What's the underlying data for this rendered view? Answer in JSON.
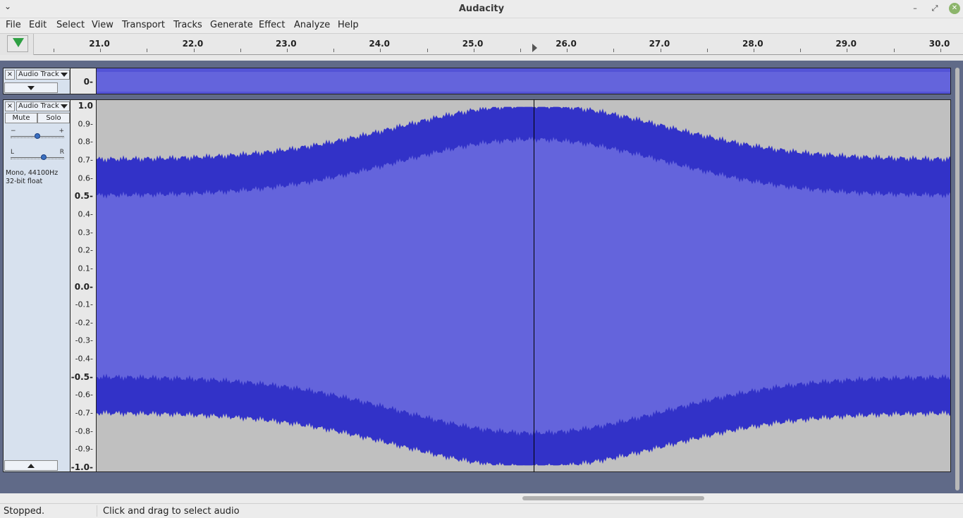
{
  "window": {
    "title": "Audacity",
    "menu_glyph": "⌄",
    "min": "–",
    "max": "⤢",
    "close": "✕"
  },
  "menu": [
    "File",
    "Edit",
    "Select",
    "View",
    "Transport",
    "Tracks",
    "Generate",
    "Effect",
    "Analyze",
    "Help"
  ],
  "ruler": {
    "labels": [
      "21.0",
      "22.0",
      "23.0",
      "24.0",
      "25.0",
      "26.0",
      "27.0",
      "28.0",
      "29.0",
      "30.0"
    ]
  },
  "tracks": [
    {
      "name": "Audio Track",
      "close": "×",
      "scale": [
        "0-"
      ]
    },
    {
      "name": "Audio Track",
      "close": "×",
      "mute": "Mute",
      "solo": "Solo",
      "gain_minus": "−",
      "gain_plus": "+",
      "pan_left": "L",
      "pan_right": "R",
      "gain_level": 0.5,
      "pan_level": 0.63,
      "info_line1": "Mono, 44100Hz",
      "info_line2": "32-bit float",
      "scale": [
        "1.0",
        "0.9-",
        "0.8-",
        "0.7-",
        "0.6-",
        "0.5-",
        "0.4-",
        "0.3-",
        "0.2-",
        "0.1-",
        "0.0-",
        "-0.1-",
        "-0.2-",
        "-0.3-",
        "-0.4-",
        "-0.5-",
        "-0.6-",
        "-0.7-",
        "-0.8-",
        "-0.9-",
        "-1.0-"
      ]
    }
  ],
  "status": {
    "state": "Stopped.",
    "hint": "Click and drag to select audio"
  },
  "colors": {
    "wave_peak": "#3232c8",
    "wave_rms": "#6464dc",
    "wave_bg": "#c0c0c0",
    "panel": "#d7e1ee",
    "play_green": "#2ea043"
  }
}
